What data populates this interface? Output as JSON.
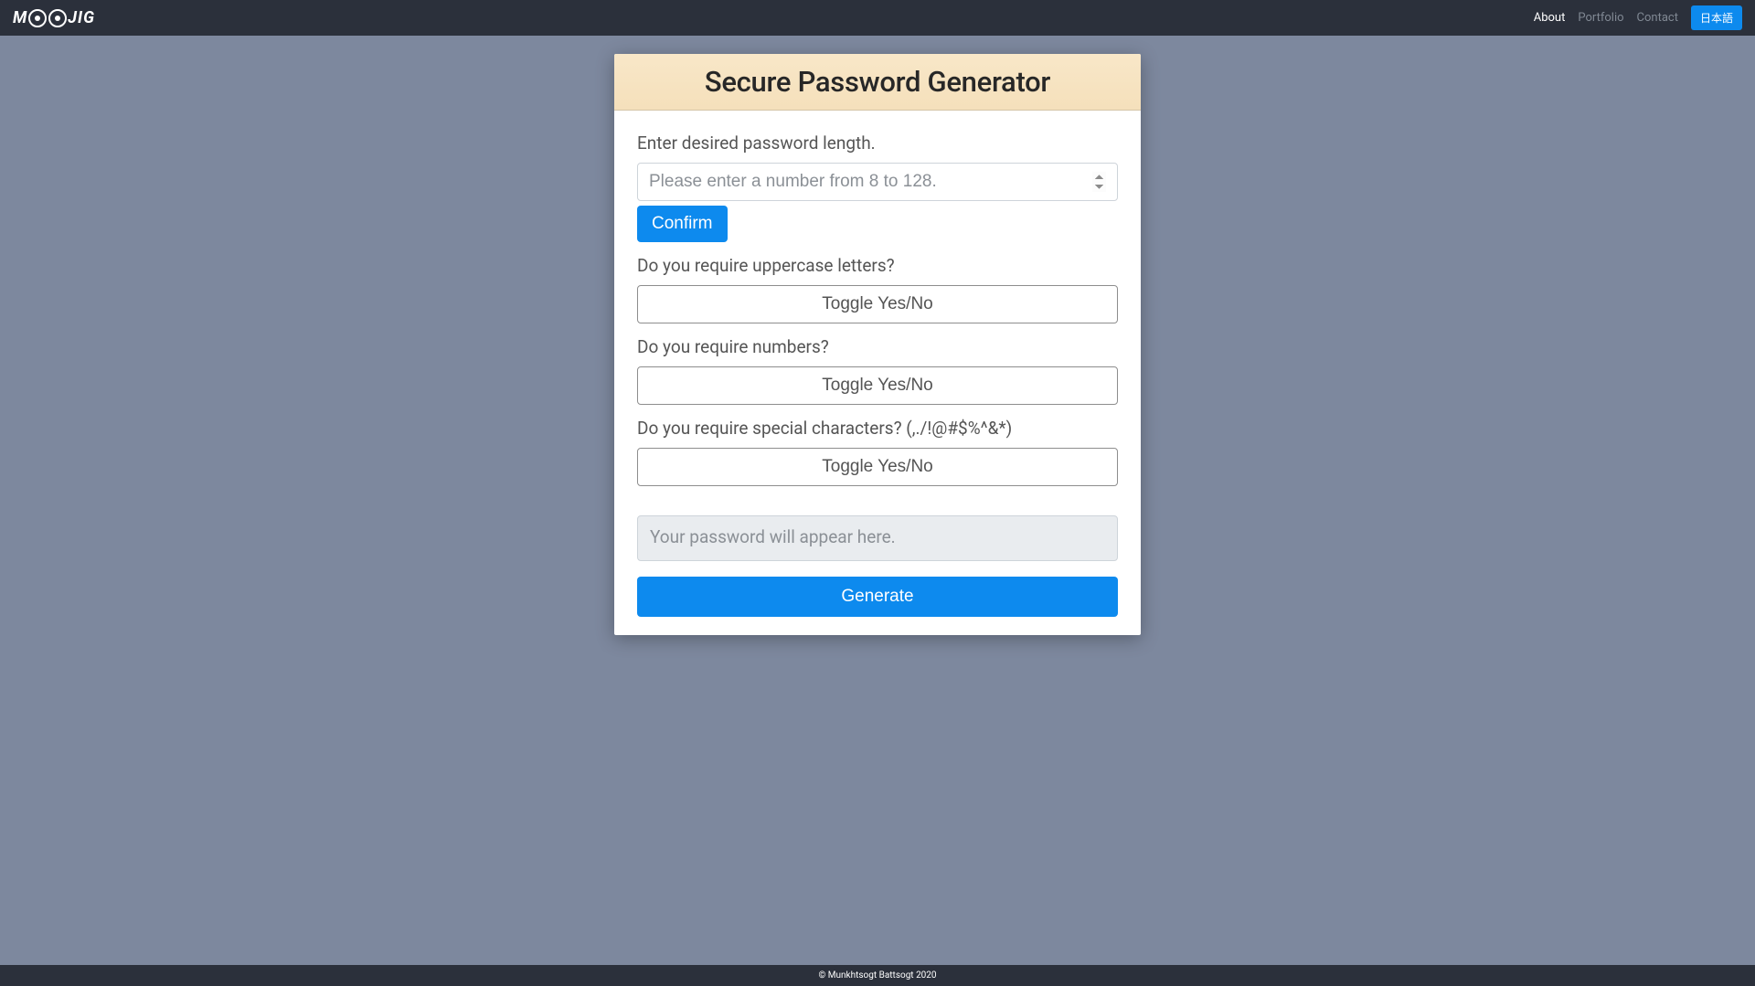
{
  "nav": {
    "brand_prefix": "M",
    "brand_suffix": "JIG",
    "links": {
      "about": "About",
      "portfolio": "Portfolio",
      "contact": "Contact"
    },
    "lang_button": "日本語"
  },
  "card": {
    "title": "Secure Password Generator",
    "length_label": "Enter desired password length.",
    "length_placeholder": "Please enter a number from 8 to 128.",
    "confirm_button": "Confirm",
    "uppercase_label": "Do you require uppercase letters?",
    "numbers_label": "Do you require numbers?",
    "special_label": "Do you require special characters? (,./!@#$%^&*)",
    "toggle_label": "Toggle Yes/No",
    "output_placeholder": "Your password will appear here.",
    "generate_button": "Generate"
  },
  "footer": {
    "copyright": "© Munkhtsogt Battsogt 2020"
  }
}
